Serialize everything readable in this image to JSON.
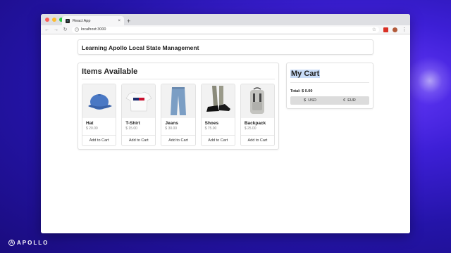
{
  "browser": {
    "tab_title": "React App",
    "tab_close": "×",
    "new_tab": "+",
    "url": "localhost:3000",
    "back": "←",
    "forward": "→",
    "reload": "↻",
    "info": "i",
    "star": "☆",
    "menu": "⋮"
  },
  "header": {
    "title": "Learning Apollo Local State Management"
  },
  "items_section": {
    "title": "Items Available",
    "items": [
      {
        "name": "Hat",
        "price": "$ 20.00",
        "button": "Add to Cart",
        "icon": "hat"
      },
      {
        "name": "T-Shirt",
        "price": "$ 15.00",
        "button": "Add to Cart",
        "icon": "tshirt"
      },
      {
        "name": "Jeans",
        "price": "$ 30.00",
        "button": "Add to Cart",
        "icon": "jeans"
      },
      {
        "name": "Shoes",
        "price": "$ 75.00",
        "button": "Add to Cart",
        "icon": "shoes"
      },
      {
        "name": "Backpack",
        "price": "$ 25.00",
        "button": "Add to Cart",
        "icon": "backpack"
      }
    ]
  },
  "cart": {
    "title": "My Cart",
    "total": "Total: $ 0.00",
    "currencies": [
      {
        "symbol": "$",
        "label": "USD"
      },
      {
        "symbol": "€",
        "label": "EUR"
      }
    ]
  },
  "footer": {
    "logo": "APOLLO",
    "logo_mark": "A"
  }
}
